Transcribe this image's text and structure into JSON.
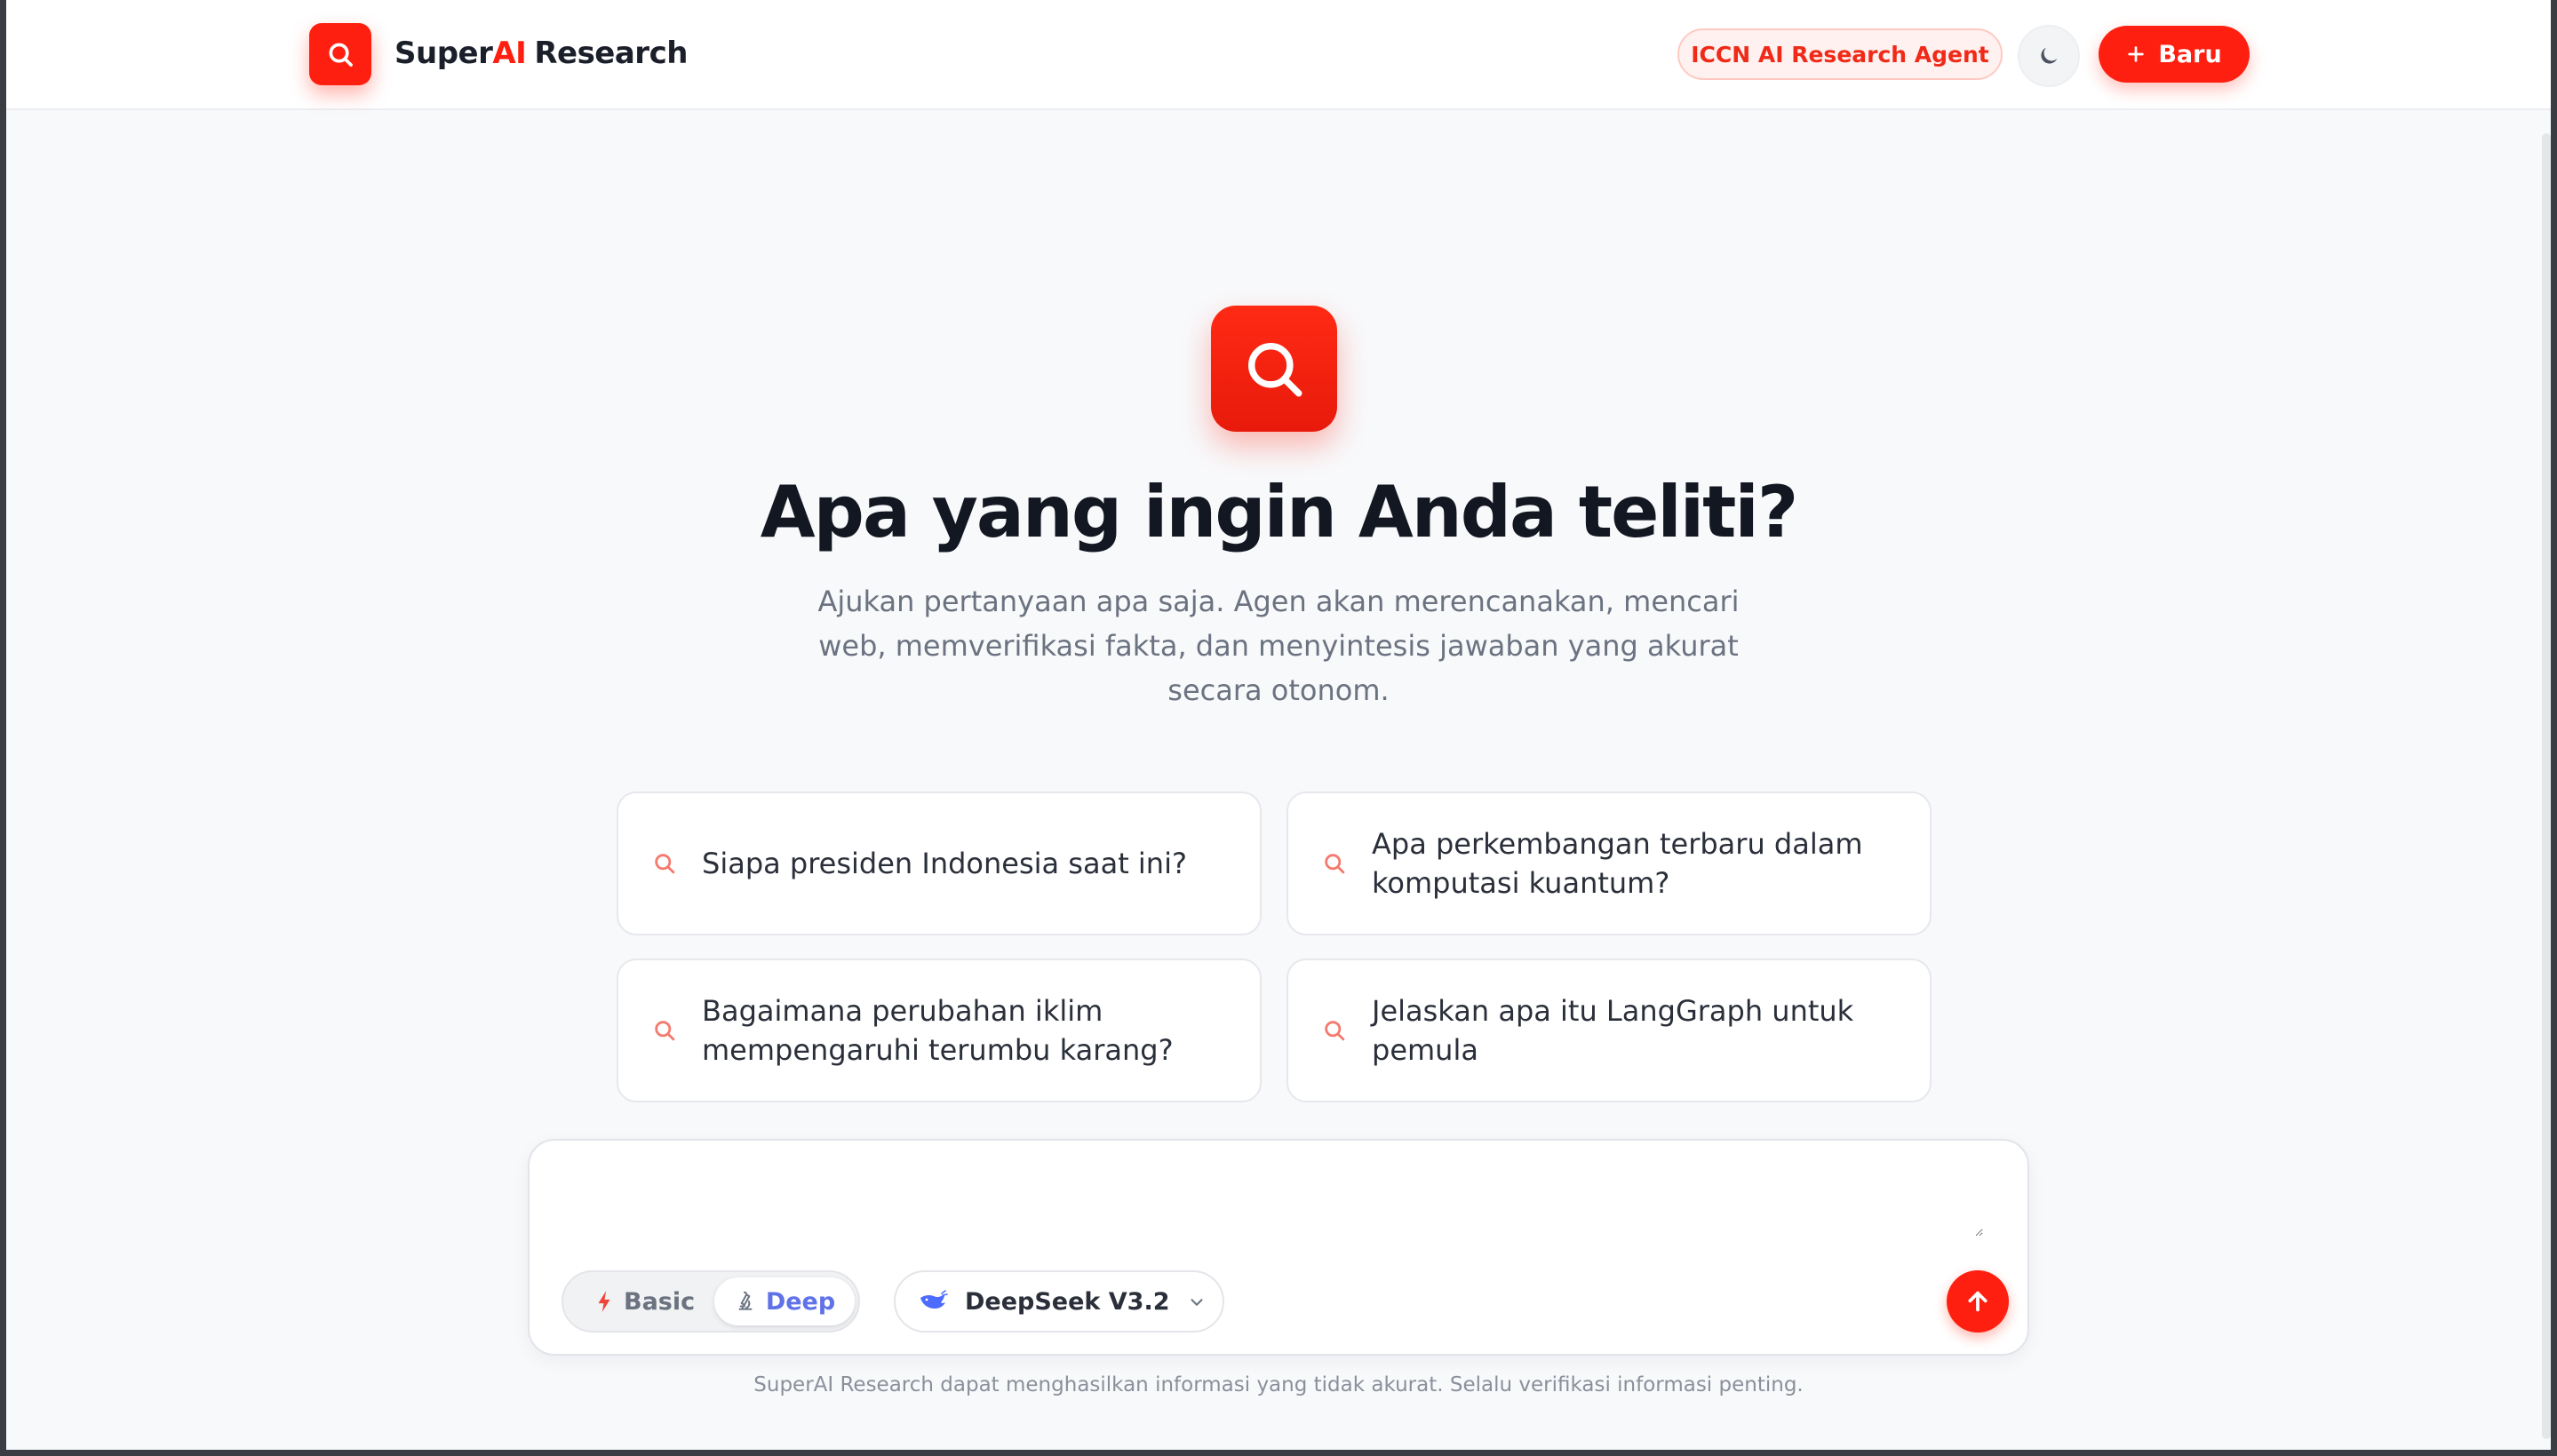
{
  "header": {
    "brand_prefix": "Super",
    "brand_accent": "AI",
    "brand_suffix": "Research",
    "agent_badge": "ICCN AI Research Agent",
    "new_button": "Baru"
  },
  "hero": {
    "title": "Apa yang ingin Anda teliti?",
    "subtitle": "Ajukan pertanyaan apa saja. Agen akan merencanakan, mencari web, memverifikasi fakta, dan menyintesis jawaban yang akurat secara otonom."
  },
  "suggestions": [
    {
      "text": "Siapa presiden Indonesia saat ini?"
    },
    {
      "text": "Apa perkembangan terbaru dalam komputasi kuantum?"
    },
    {
      "text": "Bagaimana perubahan iklim mempengaruhi terumbu karang?"
    },
    {
      "text": "Jelaskan apa itu LangGraph untuk pemula"
    }
  ],
  "composer": {
    "value": "",
    "mode_basic": "Basic",
    "mode_deep": "Deep",
    "active_mode": "Deep",
    "model": "DeepSeek V3.2"
  },
  "footer": {
    "disclaimer": "SuperAI Research dapat menghasilkan informasi yang tidak akurat. Selalu verifikasi informasi penting."
  },
  "icons": {
    "logo": "search-icon",
    "theme": "moon-icon",
    "new": "plus-icon",
    "suggestion": "search-icon",
    "basic": "lightning-icon",
    "deep": "microscope-icon",
    "model": "whale-icon",
    "dropdown": "chevron-down-icon",
    "send": "arrow-up-icon"
  },
  "colors": {
    "accent": "#ff1f10",
    "deep_mode": "#5f72e8",
    "model_icon": "#4d6bfe"
  }
}
